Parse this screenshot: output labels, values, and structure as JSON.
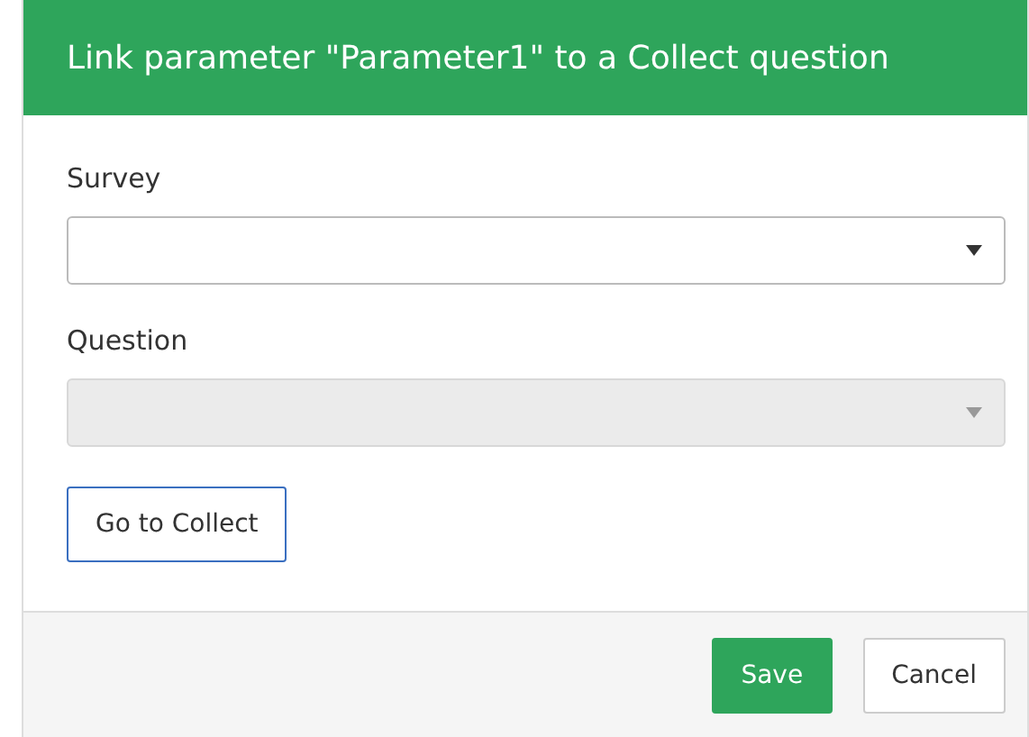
{
  "dialog": {
    "title": "Link parameter \"Parameter1\" to a Collect question"
  },
  "fields": [
    {
      "label": "Survey",
      "disabled": false
    },
    {
      "label": "Question",
      "disabled": true
    }
  ],
  "link_button": {
    "label": "Go to Collect"
  },
  "footer_buttons": [
    {
      "label": "Save",
      "kind": "primary"
    },
    {
      "label": "Cancel",
      "kind": "default"
    }
  ]
}
